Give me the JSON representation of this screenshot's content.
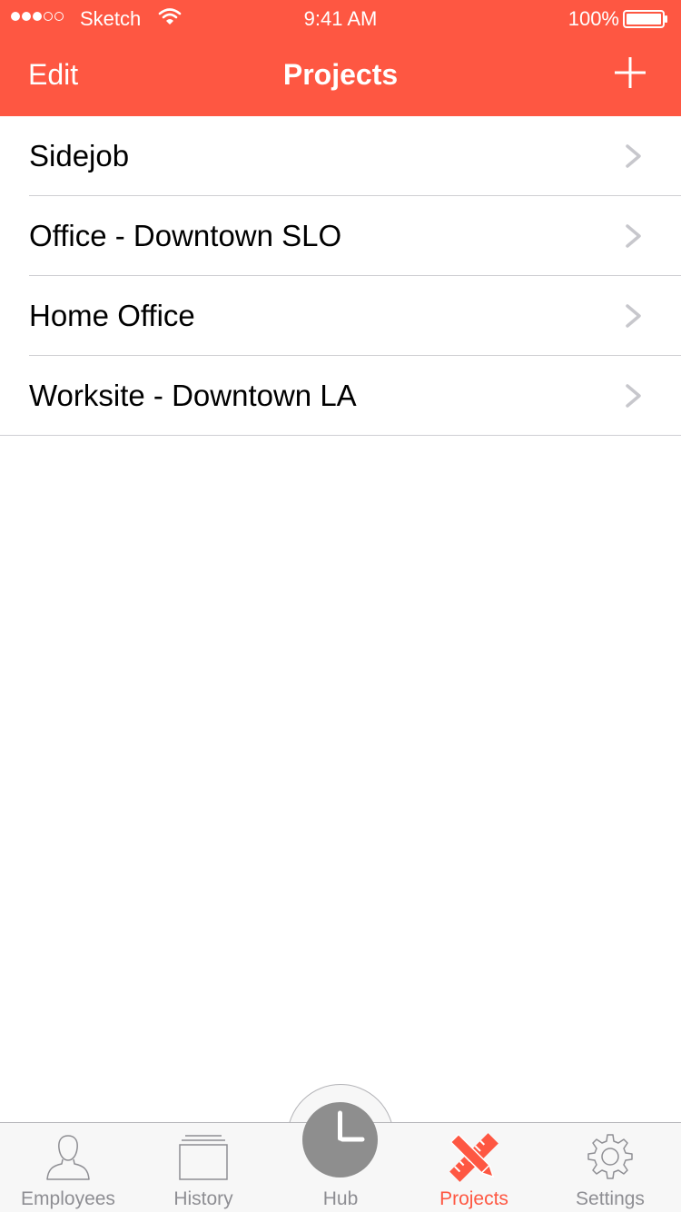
{
  "status_bar": {
    "carrier": "Sketch",
    "time": "9:41 AM",
    "battery": "100%",
    "signal_bars_filled": 3,
    "signal_bars_total": 5,
    "battery_level": 1.0
  },
  "nav": {
    "edit_label": "Edit",
    "title": "Projects",
    "add_icon": "plus-icon"
  },
  "projects": [
    {
      "name": "Sidejob"
    },
    {
      "name": "Office - Downtown SLO"
    },
    {
      "name": "Home Office"
    },
    {
      "name": "Worksite - Downtown LA"
    }
  ],
  "tab_bar": {
    "tabs": [
      {
        "label": "Employees",
        "icon": "person-icon"
      },
      {
        "label": "History",
        "icon": "history-icon"
      },
      {
        "label": "Hub",
        "icon": "clock-icon"
      },
      {
        "label": "Projects",
        "icon": "pencil-ruler-icon",
        "active": true
      },
      {
        "label": "Settings",
        "icon": "gear-icon"
      }
    ]
  },
  "colors": {
    "accent": "#fe5742",
    "inactive_tab": "#8e8e93",
    "hub_gray": "#8e8e8e",
    "separator": "#cfcfd3",
    "chevron": "#c7c7cc"
  }
}
